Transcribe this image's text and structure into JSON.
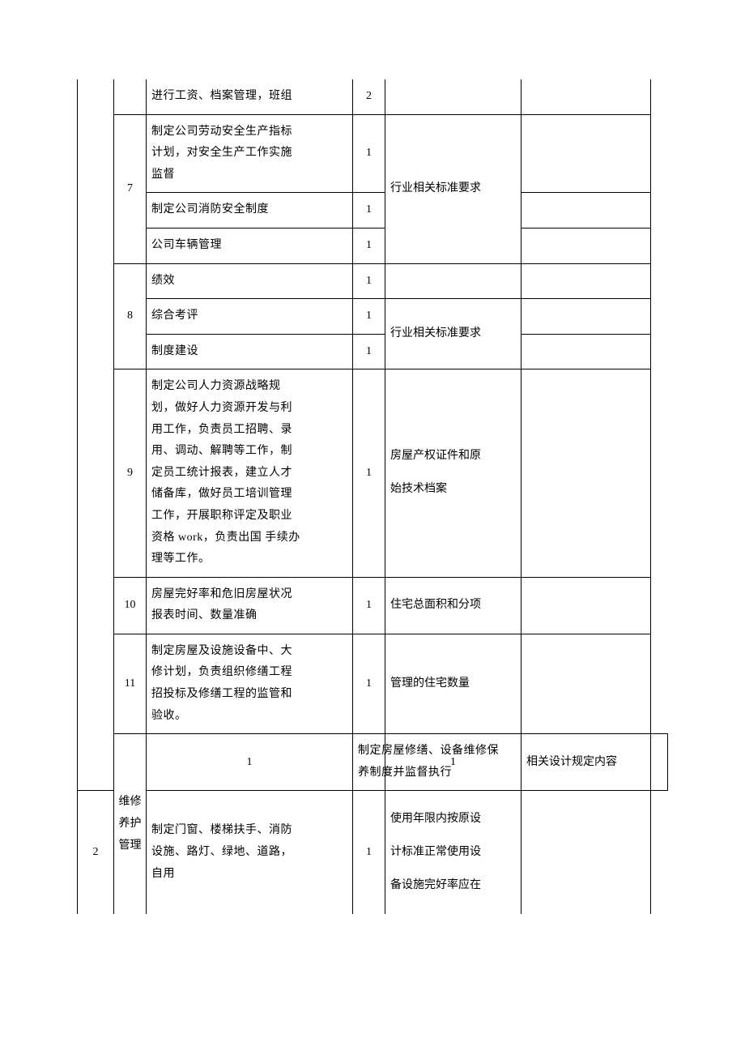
{
  "rows": [
    {
      "col1": "",
      "col2": "",
      "desc_lines": [
        "进行工资、档案管理，班组"
      ],
      "num": "2",
      "note": "",
      "empty": ""
    },
    {
      "col2_rowspan_label": "7",
      "sub": [
        {
          "desc_lines": [
            "制定公司劳动安全生产指标",
            "计划，对安全生产工作实施",
            "监督"
          ],
          "num": "1",
          "note_rowspan": "行业相关标准要求"
        },
        {
          "desc_lines": [
            "制定公司消防安全制度"
          ],
          "num": "1"
        },
        {
          "desc_lines": [
            "公司车辆管理"
          ],
          "num": "1"
        }
      ]
    },
    {
      "col2_rowspan_label": "8",
      "sub": [
        {
          "desc_lines": [
            "绩效"
          ],
          "num": "1",
          "note_top": ""
        },
        {
          "desc_lines": [
            "综合考评"
          ],
          "num": "1",
          "note_rowspan": "行业相关标准要求"
        },
        {
          "desc_lines": [
            "制度建设"
          ],
          "num": "1"
        }
      ]
    },
    {
      "col2": "9",
      "desc_lines": [
        "制定公司人力资源战略规",
        "划，做好人力资源开发与利",
        "用工作，负责员工招聘、录",
        "用、调动、解聘等工作，制",
        "定员工统计报表，建立人才",
        "储备库，做好员工培训管理",
        "工作，开展职称评定及职业",
        "资格 work，负责出国 手续办",
        "理等工作。"
      ],
      "num": "1",
      "note_lines": [
        "房屋产权证件和原",
        "始技术档案"
      ]
    },
    {
      "col2": "10",
      "desc_lines": [
        "房屋完好率和危旧房屋状况",
        "报表时间、数量准确"
      ],
      "num": "1",
      "note": "住宅总面积和分项"
    },
    {
      "col2": "11",
      "desc_lines": [
        "制定房屋及设施设备中、大",
        "修计划，负责组织修缮工程",
        "招投标及修缮工程的监管和",
        "验收。"
      ],
      "num": "1",
      "note": "管理的住宅数量"
    },
    {
      "col1_rowspan_label": [
        "维修",
        "养护",
        "管理"
      ],
      "sub": [
        {
          "col2": "1",
          "desc_lines": [
            "制定房屋修缮、设备维修保",
            "养制度并监督执行"
          ],
          "num": "1",
          "note": "相关设计规定内容"
        },
        {
          "col2": "2",
          "desc_lines": [
            "制定门窗、楼梯扶手、消防",
            "设施、路灯、绿地、道路，",
            "自用"
          ],
          "num": "1",
          "note_lines": [
            "使用年限内按原设",
            "计标准正常使用设",
            "备设施完好率应在"
          ]
        }
      ]
    }
  ]
}
